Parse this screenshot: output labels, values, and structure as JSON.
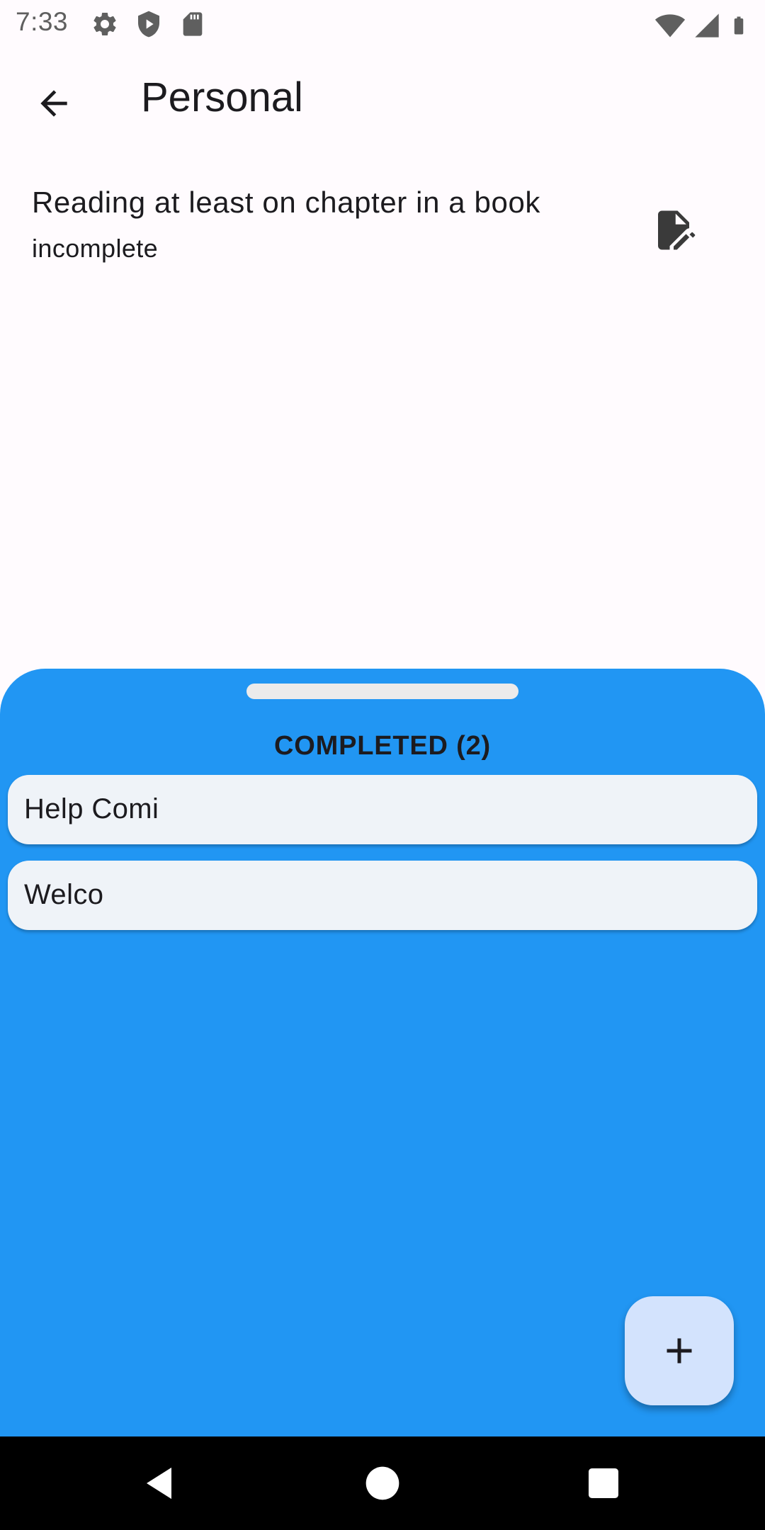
{
  "status_bar": {
    "time": "7:33",
    "icons_left": [
      "gear-icon",
      "shield-icon",
      "sd-card-icon"
    ],
    "icons_right": [
      "wifi-icon",
      "signal-icon",
      "battery-icon"
    ]
  },
  "app_bar": {
    "title": "Personal",
    "back_icon": "arrow-back-icon"
  },
  "task": {
    "title": "Reading at least on chapter in a book",
    "status": "incomplete",
    "edit_icon": "edit-document-icon"
  },
  "sheet": {
    "title": "COMPLETED (2)",
    "items": [
      {
        "label": "Help Comi"
      },
      {
        "label": "Welco"
      }
    ],
    "background_color": "#2196f3"
  },
  "fab": {
    "icon": "plus-icon"
  },
  "nav_bar": {
    "buttons": [
      "back-triangle-icon",
      "home-circle-icon",
      "recents-square-icon"
    ]
  }
}
